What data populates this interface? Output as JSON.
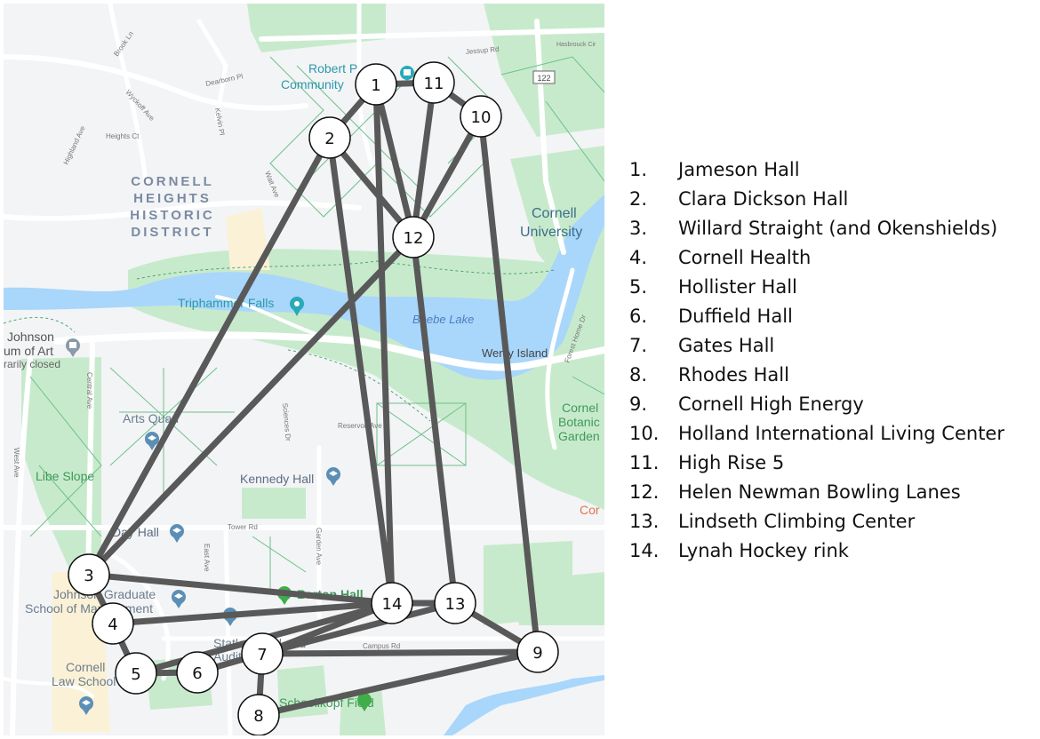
{
  "map": {
    "district_label": [
      "CORNELL",
      "HEIGHTS",
      "HISTORIC",
      "DISTRICT"
    ],
    "place_labels": {
      "robert_purcell": [
        "Robert P",
        "Community"
      ],
      "cornell_university": [
        "Cornell",
        "University"
      ],
      "triphammer_falls": "Triphammer Falls",
      "beebe_lake": "Beebe Lake",
      "wendy_island": "Wenly Island",
      "johnson_museum": [
        "Johnson",
        "um of Art",
        "rarily closed"
      ],
      "arts_quad": "Arts Quad",
      "libe_slope": "Libe Slope",
      "kennedy_hall": "Kennedy Hall",
      "day_hall": "Day Hall",
      "botanic_garden": [
        "Cornel",
        "Botanic",
        "Garden"
      ],
      "cornell_orange": "Cor",
      "johnson_graduate": [
        "Johnson Graduate",
        "School of Management"
      ],
      "barton_hall": "Barton Hall",
      "statler": [
        "Statler Hotel and",
        "Auditorium"
      ],
      "law_school": [
        "Cornell",
        "Law School"
      ],
      "schoellkopf": "Schoellkopf Field"
    },
    "street_labels": {
      "brook_ln": "Brook Ln",
      "dearborn_pl": "Dearborn Pl",
      "wyckoff_ave": "Wyckoff Ave",
      "kelvin_pl": "Kelvin Pl",
      "heights_ct": "Heights Ct",
      "highland_ave": "Highland Ave",
      "wait_ave": "Wait Ave",
      "jessup_rd": "Jessup Rd",
      "hasbrouck": "Hasbrouck Cir",
      "route_122": "122",
      "forest_home": "Forest Home Dr",
      "tower_rd": "Tower Rd",
      "east_ave": "East Ave",
      "garden_ave": "Garden Ave",
      "campus_rd": "Campus Rd",
      "central_ave": "Central Ave",
      "west_ave": "West Ave",
      "sciences_dr": "Sciences Dr",
      "reservoir_ave": "Reservoir Ave"
    }
  },
  "graph": {
    "nodes": [
      {
        "id": "1",
        "name": "Jameson Hall"
      },
      {
        "id": "2",
        "name": "Clara Dickson Hall"
      },
      {
        "id": "3",
        "name": "Willard Straight (and Okenshields)"
      },
      {
        "id": "4",
        "name": "Cornell Health"
      },
      {
        "id": "5",
        "name": "Hollister Hall"
      },
      {
        "id": "6",
        "name": "Duffield Hall"
      },
      {
        "id": "7",
        "name": "Gates Hall"
      },
      {
        "id": "8",
        "name": "Rhodes Hall"
      },
      {
        "id": "9",
        "name": "Cornell High Energy"
      },
      {
        "id": "10",
        "name": "Holland International Living Center"
      },
      {
        "id": "11",
        "name": "High Rise 5"
      },
      {
        "id": "12",
        "name": "Helen Newman Bowling Lanes"
      },
      {
        "id": "13",
        "name": "Lindseth Climbing Center"
      },
      {
        "id": "14",
        "name": "Lynah Hockey rink"
      }
    ],
    "edges": [
      [
        "1",
        "11"
      ],
      [
        "11",
        "10"
      ],
      [
        "1",
        "2"
      ],
      [
        "1",
        "12"
      ],
      [
        "1",
        "14"
      ],
      [
        "11",
        "12"
      ],
      [
        "10",
        "12"
      ],
      [
        "10",
        "9"
      ],
      [
        "2",
        "12"
      ],
      [
        "2",
        "14"
      ],
      [
        "2",
        "3"
      ],
      [
        "12",
        "3"
      ],
      [
        "12",
        "13"
      ],
      [
        "3",
        "4"
      ],
      [
        "3",
        "14"
      ],
      [
        "4",
        "5"
      ],
      [
        "4",
        "14"
      ],
      [
        "5",
        "6"
      ],
      [
        "5",
        "14"
      ],
      [
        "7",
        "14"
      ],
      [
        "7",
        "13"
      ],
      [
        "7",
        "9"
      ],
      [
        "7",
        "8"
      ],
      [
        "8",
        "9"
      ],
      [
        "14",
        "13"
      ],
      [
        "13",
        "9"
      ],
      [
        "6",
        "7"
      ]
    ]
  },
  "legend": [
    {
      "num": "1.",
      "label": "Jameson Hall"
    },
    {
      "num": "2.",
      "label": "Clara Dickson Hall"
    },
    {
      "num": "3.",
      "label": "Willard Straight (and Okenshields)"
    },
    {
      "num": "4.",
      "label": "Cornell Health"
    },
    {
      "num": "5.",
      "label": "Hollister Hall"
    },
    {
      "num": "6.",
      "label": "Duffield Hall"
    },
    {
      "num": "7.",
      "label": "Gates Hall"
    },
    {
      "num": "8.",
      "label": "Rhodes Hall"
    },
    {
      "num": "9.",
      "label": "Cornell High Energy"
    },
    {
      "num": "10.",
      "label": "Holland International Living Center"
    },
    {
      "num": "11.",
      "label": "High Rise 5"
    },
    {
      "num": "12.",
      "label": "Helen Newman Bowling Lanes"
    },
    {
      "num": "13.",
      "label": "Lindseth Climbing Center"
    },
    {
      "num": "14.",
      "label": "Lynah Hockey rink"
    }
  ],
  "colors": {
    "map_bg": "#f3f4f6",
    "park": "#c8eacc",
    "water": "#a9d6fb",
    "road": "#ffffff",
    "path": "#6cc18a",
    "campus_tan": "#fbf1d6",
    "edge": "#595959",
    "node_fill": "#ffffff",
    "node_stroke": "#111111",
    "label_blue": "#3b7a9e",
    "label_green": "#3f9a5a",
    "district": "#7b8aa2"
  }
}
